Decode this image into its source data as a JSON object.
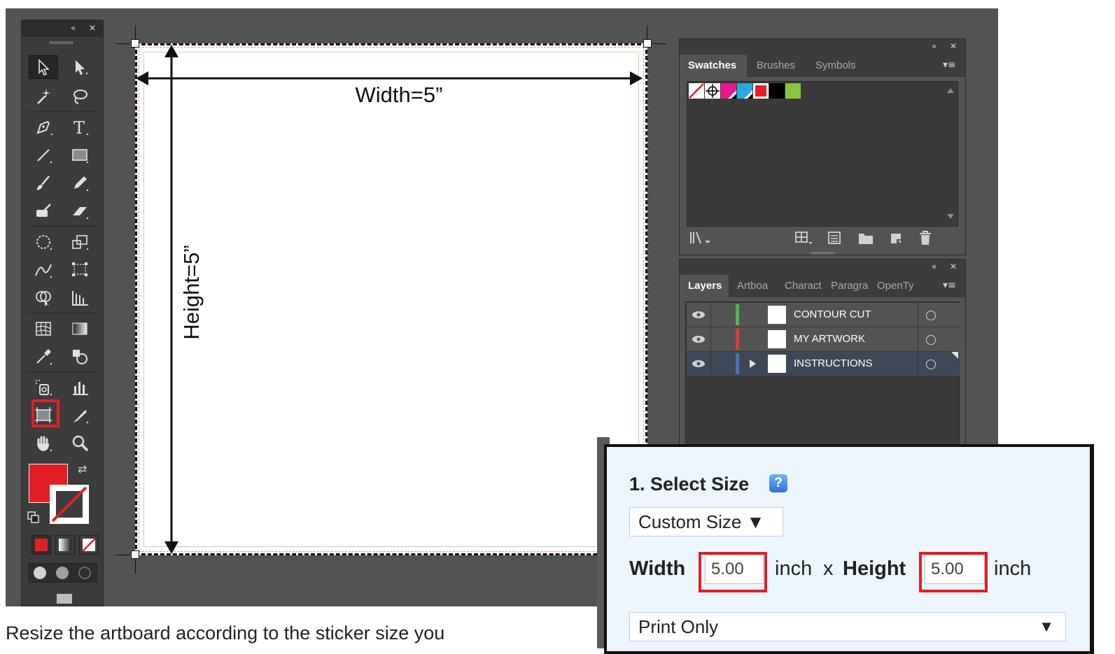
{
  "artboard": {
    "width_label": "Width=5”",
    "height_label": "Height=5”"
  },
  "swatches_panel": {
    "tabs": [
      {
        "label": "Swatches",
        "active": true
      },
      {
        "label": "Brushes",
        "active": false
      },
      {
        "label": "Symbols",
        "active": false
      }
    ],
    "swatch_colors": [
      "none",
      "registration",
      "#e8178a",
      "#29a9e0",
      "#e21f26",
      "#000000",
      "#8bc53f"
    ]
  },
  "layers_panel": {
    "tabs": [
      {
        "label": "Layers",
        "active": true
      },
      {
        "label": "Artboa",
        "active": false
      },
      {
        "label": "Charact",
        "active": false
      },
      {
        "label": "Paragra",
        "active": false
      },
      {
        "label": "OpenTy",
        "active": false
      }
    ],
    "layers": [
      {
        "name": "CONTOUR CUT",
        "color": "#4fb848",
        "selected": false,
        "expandable": false
      },
      {
        "name": "MY ARTWORK",
        "color": "#d8403f",
        "selected": false,
        "expandable": false
      },
      {
        "name": "INSTRUCTIONS",
        "color": "#4f6fb0",
        "selected": true,
        "expandable": true
      }
    ]
  },
  "panel_controls": {
    "collapse": "«",
    "close": "✕",
    "menu": "▾≡"
  },
  "size_form": {
    "title": "1. Select Size",
    "help_icon": "?",
    "size_select": "Custom Size ▼",
    "width_label": "Width",
    "width_value": "5.00",
    "unit": "inch",
    "times": "x",
    "height_label": "Height",
    "height_value": "5.00",
    "print_select": "Print Only",
    "print_arrow": "▼"
  },
  "caption": "Resize the artboard according to the sticker size you"
}
